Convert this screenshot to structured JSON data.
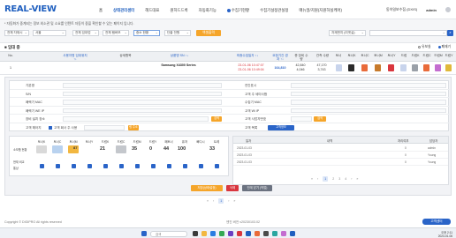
{
  "header": {
    "logo": "REAL-VIEW",
    "nav": [
      "홈",
      "상태관리센터",
      "헤드대표",
      "원하드드록",
      "자동화기능",
      "수집기현황",
      "수집기설정관실정",
      "매뉴얼/지원(지원하실케어)"
    ],
    "active_nav": 1,
    "user": "admin",
    "org": "동아일보수집 (DXIS)",
    "logout": "로그아웃"
  },
  "filters": {
    "hint": "* 자동화가 중계되는 정보 외소관 및 소요를 인텐트 자동이 중을 확인할 수 있는 페이지 입니다.",
    "selects": [
      "전체 자재시",
      "서울",
      "전체 임대업",
      "전체 탬버모",
      "중소 한황",
      "단출 전원"
    ],
    "excel_button": "엑셀출력",
    "right_select": "자재번지 (리셋실)",
    "search_placeholder": "",
    "search_icon": "search-icon"
  },
  "section": {
    "title": "■ 임대 중",
    "opt1": "유보실",
    "opt2": "폐재기"
  },
  "table": {
    "headers": [
      "No.",
      "사용자명\n임대위치 ↑↓",
      "상세항목",
      "상품명\nSN ↑↓",
      "최종수집일자 ↑↓",
      "요청기간\n경과 ↑↓",
      "총 장비\n수량",
      "관측\n수량",
      "토너",
      "토너K",
      "토너C",
      "토너M",
      "토너Y",
      "드럼",
      "드럼K",
      "드럼C",
      "드럼M",
      "드럼Y"
    ],
    "row": {
      "no": "1",
      "product": "Samsung X4300 Series",
      "date1": "23-01-06 10:47:07",
      "date2": "23-01-06 10:49:04",
      "count_link": "164,810",
      "v1": "42,840",
      "v2": "4,046",
      "v3": "47,170",
      "v4": "3,743"
    }
  },
  "form": {
    "labels_left": [
      "기본명",
      "S/N",
      "폐렉기 MAC",
      "폐렉기 WE IP",
      "장비 설치 장소",
      "고객 해아지"
    ],
    "labels_right": [
      "연간표시",
      "고객 주 세미사합",
      "수집기 MAC",
      "고객 Wi IP",
      "고객 사업자번호",
      "고객 목록"
    ],
    "checkbox_label": "고객 회사 주 사용",
    "search_btn": "검색",
    "search_btn2": "검색",
    "addr_btn": "링 주소",
    "customer_btn": "고객정보"
  },
  "stats": {
    "headers": [
      "토너K",
      "토너C",
      "토너M",
      "토너Y",
      "드럼K",
      "드럼C",
      "드럼M",
      "드럼Y",
      "폐토너",
      "퓨저",
      "빠디시",
      "트레"
    ],
    "row_label_1": "소모품 현황",
    "row_label_2": "현재 비교",
    "row_label_3": "통상",
    "values": [
      "87",
      "21",
      "35",
      "0",
      "44",
      "100",
      "33"
    ]
  },
  "log": {
    "headers": [
      "일자",
      "내역",
      "처리여부",
      "담당자"
    ],
    "rows": [
      {
        "date": "2023-01-03",
        "text": "",
        "count": "0",
        "user": "admin"
      },
      {
        "date": "2023-01-03",
        "text": "",
        "count": "0",
        "user": "Young"
      },
      {
        "date": "2023-01-03",
        "text": "",
        "count": "0",
        "user": "Young"
      }
    ],
    "pages": [
      "«",
      "‹",
      "1",
      "2",
      "3",
      "4",
      "›",
      "»"
    ],
    "current_page": "1"
  },
  "actions": {
    "save": "저장(상태설정)",
    "delete": "삭제",
    "close": "단계 닫기 (작업)"
  },
  "pager": {
    "pages": [
      "«",
      "‹",
      "1",
      "›",
      "»"
    ],
    "current": "1"
  },
  "footer": {
    "copyright": "Copyright © DIGIPRO All rights reserved",
    "version": "엔진 버전 v20230103.02",
    "help_btn": "고객센터"
  },
  "taskbar": {
    "search_placeholder": "검색",
    "time": "오후 2:11",
    "date": "2023-01-06"
  },
  "colors": {
    "accent": "#2a64c8",
    "orange": "#f5a52a",
    "red": "#d9363e"
  }
}
